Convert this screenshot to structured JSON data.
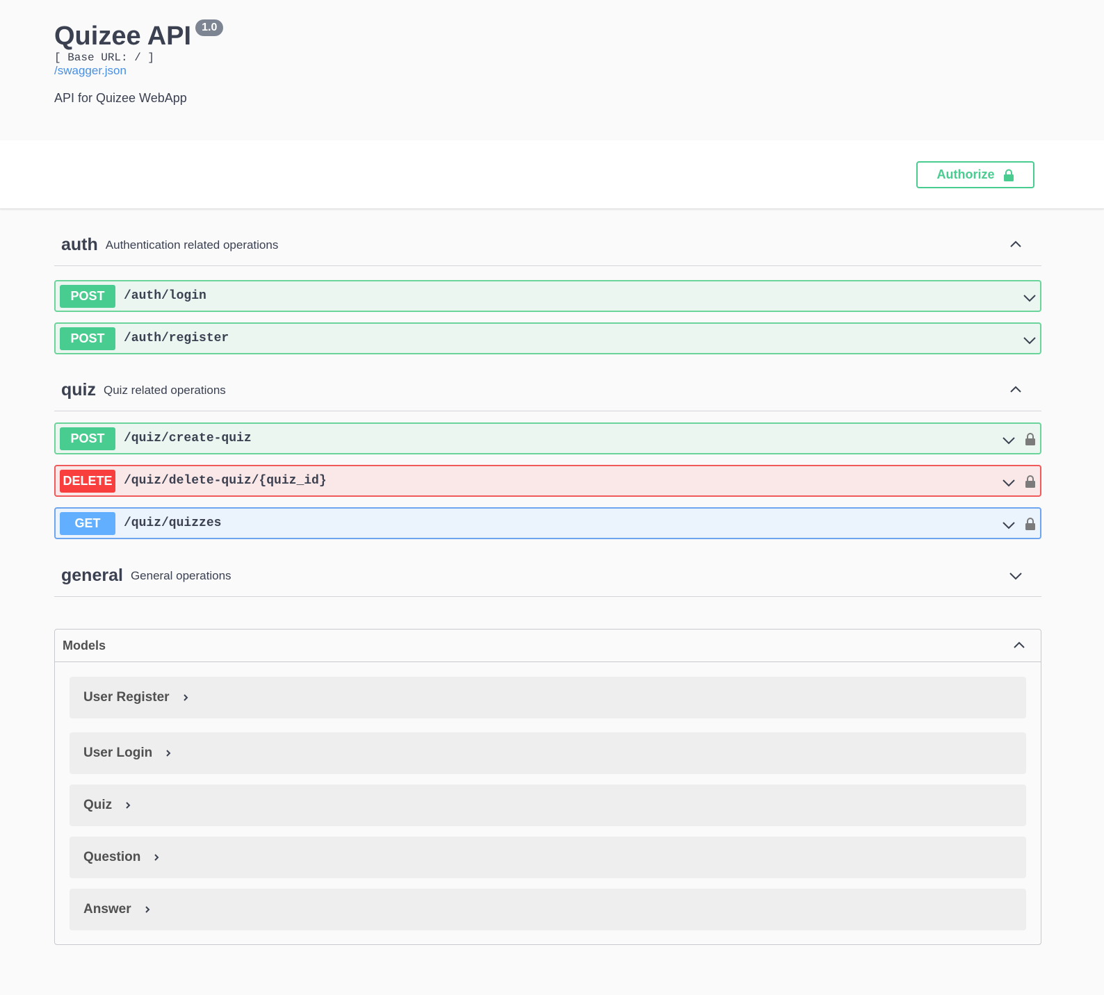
{
  "info": {
    "title": "Quizee API",
    "version": "1.0",
    "base_url": "[ Base URL: / ]",
    "spec_link": "/swagger.json",
    "description": "API for Quizee WebApp"
  },
  "scheme_bar": {
    "authorize_label": "Authorize"
  },
  "tags": [
    {
      "name": "auth",
      "description": "Authentication related operations",
      "expanded": true,
      "operations": [
        {
          "method": "POST",
          "path": "/auth/login",
          "locked": false
        },
        {
          "method": "POST",
          "path": "/auth/register",
          "locked": false
        }
      ]
    },
    {
      "name": "quiz",
      "description": "Quiz related operations",
      "expanded": true,
      "operations": [
        {
          "method": "POST",
          "path": "/quiz/create-quiz",
          "locked": true
        },
        {
          "method": "DELETE",
          "path": "/quiz/delete-quiz/{quiz_id}",
          "locked": true
        },
        {
          "method": "GET",
          "path": "/quiz/quizzes",
          "locked": true
        }
      ]
    },
    {
      "name": "general",
      "description": "General operations",
      "expanded": false,
      "operations": []
    }
  ],
  "models": {
    "title": "Models",
    "items": [
      {
        "name": "User Register"
      },
      {
        "name": "User Login"
      },
      {
        "name": "Quiz"
      },
      {
        "name": "Question"
      },
      {
        "name": "Answer"
      }
    ]
  },
  "colors": {
    "post": "#49cc90",
    "delete": "#f93e3e",
    "get": "#61affe",
    "link": "#4990e2",
    "version_badge": "#7d8492"
  }
}
